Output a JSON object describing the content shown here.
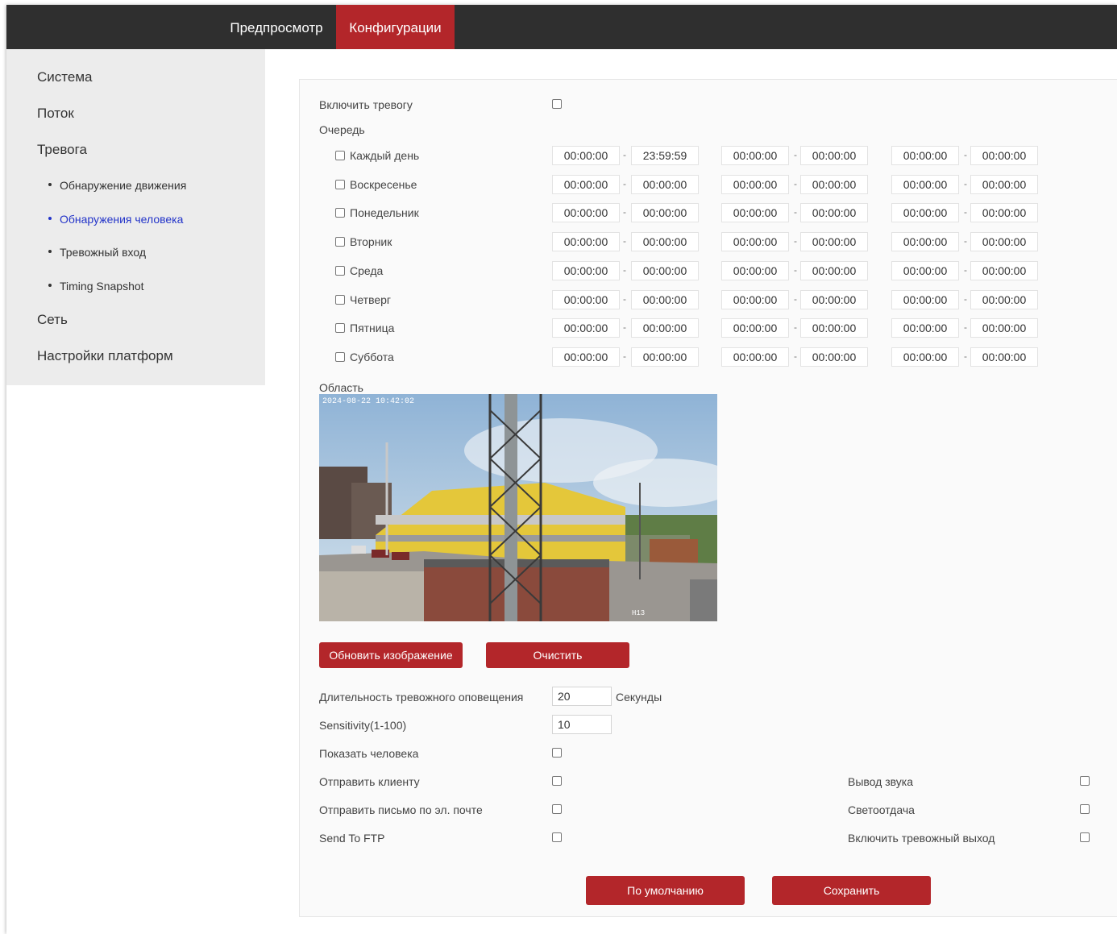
{
  "nav": {
    "tabs": [
      {
        "label": "Предпросмотр"
      },
      {
        "label": "Конфигурации",
        "active": true
      }
    ]
  },
  "sidebar": {
    "items": [
      {
        "label": "Система"
      },
      {
        "label": "Поток"
      },
      {
        "label": "Тревога"
      },
      {
        "label": "Сеть"
      },
      {
        "label": "Настройки платформ"
      }
    ],
    "subitems": [
      {
        "label": "Обнаружение движения"
      },
      {
        "label": "Обнаружения человека",
        "active": true
      },
      {
        "label": "Тревожный вход"
      },
      {
        "label": "Timing Snapshot"
      }
    ]
  },
  "form": {
    "enable_alarm_label": "Включить тревогу",
    "schedule_label": "Очередь",
    "days": [
      {
        "label": "Каждый день",
        "times": [
          "00:00:00",
          "23:59:59",
          "00:00:00",
          "00:00:00",
          "00:00:00",
          "00:00:00"
        ]
      },
      {
        "label": "Воскресенье",
        "times": [
          "00:00:00",
          "00:00:00",
          "00:00:00",
          "00:00:00",
          "00:00:00",
          "00:00:00"
        ]
      },
      {
        "label": "Понедельник",
        "times": [
          "00:00:00",
          "00:00:00",
          "00:00:00",
          "00:00:00",
          "00:00:00",
          "00:00:00"
        ]
      },
      {
        "label": "Вторник",
        "times": [
          "00:00:00",
          "00:00:00",
          "00:00:00",
          "00:00:00",
          "00:00:00",
          "00:00:00"
        ]
      },
      {
        "label": "Среда",
        "times": [
          "00:00:00",
          "00:00:00",
          "00:00:00",
          "00:00:00",
          "00:00:00",
          "00:00:00"
        ]
      },
      {
        "label": "Четверг",
        "times": [
          "00:00:00",
          "00:00:00",
          "00:00:00",
          "00:00:00",
          "00:00:00",
          "00:00:00"
        ]
      },
      {
        "label": "Пятница",
        "times": [
          "00:00:00",
          "00:00:00",
          "00:00:00",
          "00:00:00",
          "00:00:00",
          "00:00:00"
        ]
      },
      {
        "label": "Суббота",
        "times": [
          "00:00:00",
          "00:00:00",
          "00:00:00",
          "00:00:00",
          "00:00:00",
          "00:00:00"
        ]
      }
    ],
    "time_separator": "-",
    "area_label": "Область",
    "camera_timestamp": "2024-08-22 10:42:02",
    "camera_id": "H13",
    "refresh_button": "Обновить изображение",
    "clear_button": "Очистить",
    "duration_label": "Длительность тревожного оповещения",
    "duration_value": "20",
    "duration_unit": "Секунды",
    "sensitivity_label": "Sensitivity(1-100)",
    "sensitivity_value": "10",
    "show_person_label": "Показать человека",
    "send_client_label": "Отправить клиенту",
    "send_email_label": "Отправить письмо по эл. почте",
    "send_ftp_label": "Send To FTP",
    "sound_output_label": "Вывод звука",
    "light_output_label": "Светоотдача",
    "alarm_output_label": "Включить тревожный выход",
    "default_button": "По умолчанию",
    "save_button": "Сохранить"
  },
  "colors": {
    "accent": "#b3262a",
    "topbar": "#2f2f2f",
    "sidebar_bg": "#ececec",
    "link_active": "#2334c9"
  }
}
